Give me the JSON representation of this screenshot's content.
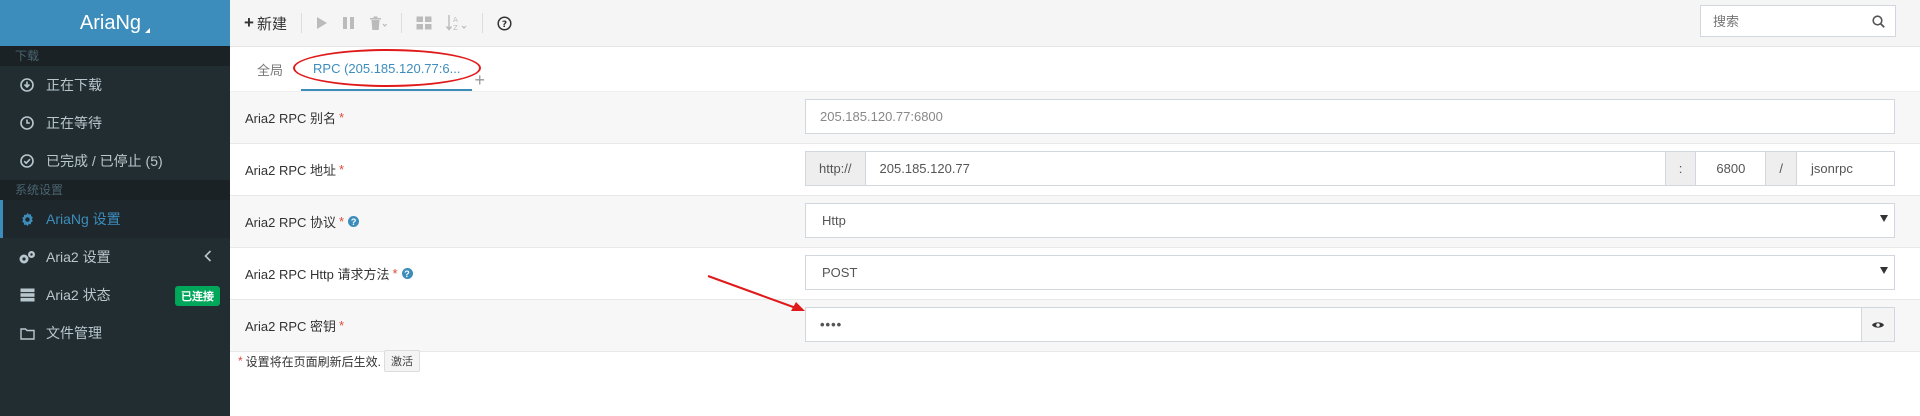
{
  "app": {
    "title": "AriaNg"
  },
  "sidebar": {
    "section_download": "下载",
    "items_download": [
      {
        "label": "正在下载",
        "icon": "download-icon"
      },
      {
        "label": "正在等待",
        "icon": "clock-icon"
      },
      {
        "label": "已完成 / 已停止 (5)",
        "icon": "check-circle-icon"
      }
    ],
    "section_settings": "系统设置",
    "ariang_settings": "AriaNg 设置",
    "aria2_settings": "Aria2 设置",
    "aria2_status": "Aria2 状态",
    "aria2_status_badge": "已连接",
    "file_manager": "文件管理"
  },
  "toolbar": {
    "new_label": "新建",
    "search_placeholder": "搜索"
  },
  "tabs": {
    "global": "全局",
    "rpc": "RPC (205.185.120.77:6..."
  },
  "form": {
    "alias": {
      "label": "Aria2 RPC 别名",
      "value": "205.185.120.77:6800"
    },
    "address": {
      "label": "Aria2 RPC 地址",
      "scheme": "http://",
      "host": "205.185.120.77",
      "colon": ":",
      "port": "6800",
      "slash": "/",
      "path": "jsonrpc"
    },
    "protocol": {
      "label": "Aria2 RPC 协议",
      "value": "Http"
    },
    "method": {
      "label": "Aria2 RPC Http 请求方法",
      "value": "POST"
    },
    "secret": {
      "label": "Aria2 RPC 密钥",
      "value": "••••"
    }
  },
  "footnote": {
    "text": "设置将在页面刷新后生效.",
    "button": "激活"
  },
  "colors": {
    "accent": "#3c8dbc",
    "sidebar_bg": "#222d32",
    "success": "#00a65a",
    "required": "#dd4b39",
    "annotation": "#e01a1a"
  }
}
